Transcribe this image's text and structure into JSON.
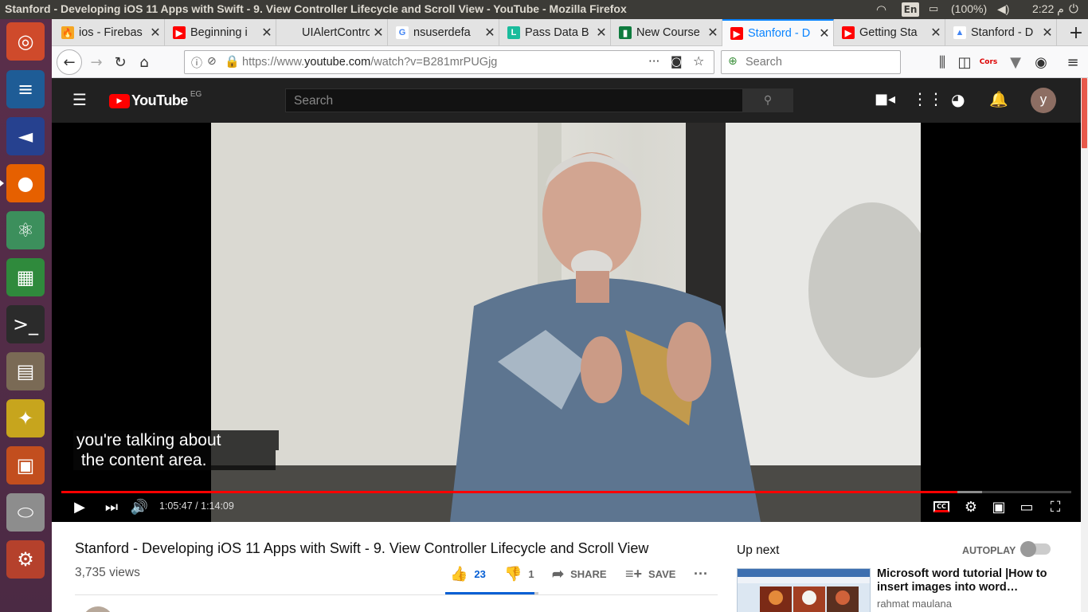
{
  "system": {
    "window_title": "Stanford - Developing iOS 11 Apps with Swift - 9. View Controller Lifecycle and Scroll View - YouTube - Mozilla Firefox",
    "keyboard_layout": "En",
    "battery": "(100%)",
    "clock": "2:22 م"
  },
  "launcher": {
    "items": [
      {
        "name": "ubuntu-dash-icon",
        "glyph": "◎",
        "bg": "#cf4a2b"
      },
      {
        "name": "writer-icon",
        "glyph": "≡",
        "bg": "#1e5c96"
      },
      {
        "name": "vscode-icon",
        "glyph": "◄",
        "bg": "#26418f"
      },
      {
        "name": "firefox-icon",
        "glyph": "●",
        "bg": "#e66000"
      },
      {
        "name": "atom-icon",
        "glyph": "⚛",
        "bg": "#3c8f5c"
      },
      {
        "name": "calc-icon",
        "glyph": "▦",
        "bg": "#2f8a3c"
      },
      {
        "name": "terminal-icon",
        "glyph": ">_",
        "bg": "#2b2b2b"
      },
      {
        "name": "files-icon",
        "glyph": "▤",
        "bg": "#7a6a55"
      },
      {
        "name": "puzzle-app-icon",
        "glyph": "✦",
        "bg": "#c7a51d"
      },
      {
        "name": "impress-icon",
        "glyph": "▣",
        "bg": "#c24e1e"
      },
      {
        "name": "drive-icon",
        "glyph": "⬭",
        "bg": "#8d8d8d"
      },
      {
        "name": "settings-icon",
        "glyph": "⚙",
        "bg": "#b5412c"
      }
    ]
  },
  "tabs": [
    {
      "label": "ios - Firebas",
      "fav": "🔥",
      "favbg": "#f5a623",
      "active": false
    },
    {
      "label": "Beginning i",
      "fav": "▶",
      "favbg": "#ff0000",
      "active": false
    },
    {
      "label": "UIAlertControl",
      "fav": "",
      "favbg": "transparent",
      "active": false
    },
    {
      "label": "nsuserdefa",
      "fav": "G",
      "favbg": "#ffffff",
      "active": false
    },
    {
      "label": "Pass Data B",
      "fav": "L",
      "favbg": "#1abc9c",
      "active": false
    },
    {
      "label": "New Course",
      "fav": "▮",
      "favbg": "#0f7b3e",
      "active": false
    },
    {
      "label": "Stanford - D",
      "fav": "▶",
      "favbg": "#ff0000",
      "active": true
    },
    {
      "label": "Getting Sta",
      "fav": "▶",
      "favbg": "#ff0000",
      "active": false
    },
    {
      "label": "Stanford - D",
      "fav": "▲",
      "favbg": "#ffffff",
      "active": false
    }
  ],
  "navbar": {
    "url_prefix": "https://www.",
    "url_domain": "youtube.com",
    "url_path": "/watch?v=B281mrPUGjg",
    "search_placeholder": "Search"
  },
  "youtube": {
    "logo_text": "YouTube",
    "region": "EG",
    "search_placeholder": "Search",
    "avatar_letter": "y"
  },
  "player": {
    "caption_line1": "you're talking about",
    "caption_line2": " the content area.",
    "time_display": "1:05:47 / 1:14:09",
    "progress_fraction": 0.887,
    "buffer_fraction": 0.912
  },
  "video": {
    "title": "Stanford - Developing iOS 11 Apps with Swift - 9. View Controller Lifecycle and Scroll View",
    "views": "3,735 views",
    "likes": "23",
    "dislikes": "1",
    "share_label": "SHARE",
    "save_label": "SAVE",
    "like_fraction": 0.958
  },
  "sidebar": {
    "up_next_label": "Up next",
    "autoplay_label": "AUTOPLAY",
    "next_video_title": "Microsoft word tutorial |How to insert images into word…",
    "next_video_channel": "rahmat maulana"
  }
}
